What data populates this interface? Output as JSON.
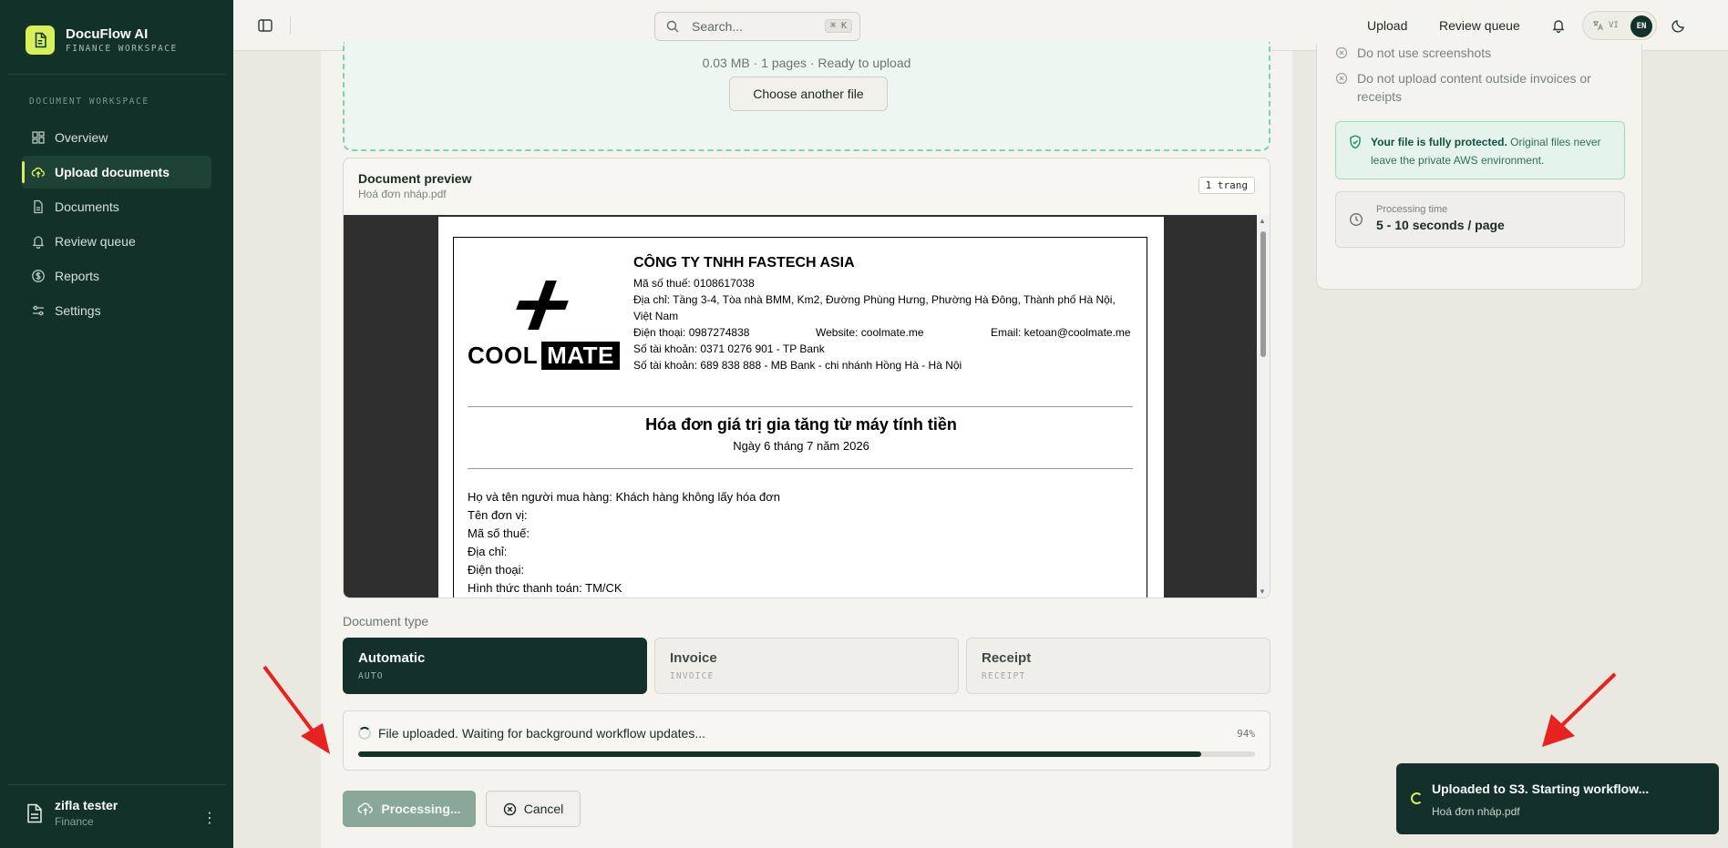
{
  "brand": {
    "name": "DocuFlow AI",
    "subtitle": "FINANCE WORKSPACE",
    "accent": "#d7ef5a"
  },
  "sidebar": {
    "section_label": "DOCUMENT WORKSPACE",
    "items": [
      {
        "label": "Overview",
        "icon": "grid-icon",
        "active": false
      },
      {
        "label": "Upload documents",
        "icon": "cloud-upload-icon",
        "active": true
      },
      {
        "label": "Documents",
        "icon": "file-icon",
        "active": false
      },
      {
        "label": "Review queue",
        "icon": "bell-icon",
        "active": false
      },
      {
        "label": "Reports",
        "icon": "dollar-icon",
        "active": false
      },
      {
        "label": "Settings",
        "icon": "sliders-icon",
        "active": false
      }
    ],
    "user": {
      "name": "zifla tester",
      "role": "Finance"
    }
  },
  "topbar": {
    "search_placeholder": "Search...",
    "search_shortcut": "⌘ K",
    "links": {
      "upload": "Upload",
      "review_queue": "Review queue"
    },
    "lang": {
      "vi": "VI",
      "en": "EN"
    }
  },
  "upload": {
    "file_meta": "0.03 MB · 1 pages · Ready to upload",
    "choose_another": "Choose another file"
  },
  "preview": {
    "title": "Document preview",
    "filename": "Hoá đơn nháp.pdf",
    "page_count": "1 trang",
    "invoice": {
      "logo_text": "COOL",
      "logo_text2": "MATE",
      "company": "CÔNG TY TNHH FASTECH ASIA",
      "tax_code": "Mã số thuế: 0108617038",
      "address": "Địa chỉ: Tầng 3-4, Tòa nhà BMM, Km2, Đường Phùng Hưng, Phường Hà Đông, Thành phố Hà Nội, Việt Nam",
      "phone": "Điện thoại: 0987274838",
      "website": "Website: coolmate.me",
      "email": "Email: ketoan@coolmate.me",
      "account1": "Số tài khoản: 0371 0276 901 - TP Bank",
      "account2": "Số tài khoản: 689 838 888 - MB Bank - chi nhánh Hồng Hà - Hà Nội",
      "title": "Hóa đơn giá trị gia tăng từ máy tính tiền",
      "date": "Ngày 6 tháng 7 năm 2026",
      "buyer_lines": [
        "Họ và tên người mua hàng: Khách hàng không lấy hóa đơn",
        "Tên đơn vị:",
        "Mã số thuế:",
        "Địa chỉ:",
        "Điện thoại:",
        "Hình thức thanh toán: TM/CK"
      ]
    }
  },
  "document_type": {
    "label": "Document type",
    "options": [
      {
        "name": "Automatic",
        "code": "AUTO",
        "selected": true
      },
      {
        "name": "Invoice",
        "code": "INVOICE",
        "selected": false
      },
      {
        "name": "Receipt",
        "code": "RECEIPT",
        "selected": false
      }
    ]
  },
  "progress": {
    "text": "File uploaded. Waiting for background workflow updates...",
    "percent_label": "94%",
    "value": 94
  },
  "actions": {
    "processing": "Processing...",
    "cancel": "Cancel"
  },
  "guidelines": {
    "rules": [
      "Do not use screenshots",
      "Do not upload content outside invoices or receipts"
    ],
    "protect_bold": "Your file is fully protected.",
    "protect_rest": " Original files never leave the private AWS environment.",
    "processing_time_label": "Processing time",
    "processing_time_value": "5 - 10 seconds / page"
  },
  "toast": {
    "title": "Uploaded to S3. Starting workflow...",
    "subtitle": "Hoá đơn nháp.pdf"
  }
}
